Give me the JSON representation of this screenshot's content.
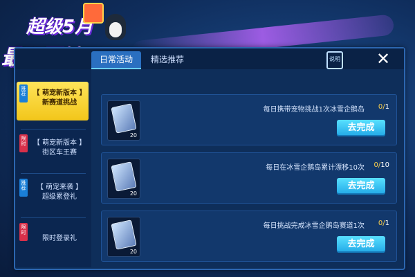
{
  "banner": {
    "line1": "超级5月",
    "line2": "最强回馈"
  },
  "tabs": [
    {
      "label": "日常活动",
      "active": true
    },
    {
      "label": "精选推荐",
      "active": false
    }
  ],
  "header": {
    "doc_label": "说明",
    "close_symbol": "✕"
  },
  "sidebar": {
    "items": [
      {
        "tag": "推荐",
        "tag_color": "#1a7fd8",
        "label": "【 萌宠新版本 】\n新赛道挑战",
        "active": true
      },
      {
        "tag": "限时",
        "tag_color": "#d8304a",
        "label": "【 萌宠新版本 】\n街区车王赛",
        "active": false
      },
      {
        "tag": "推荐",
        "tag_color": "#1a7fd8",
        "label": "【 萌宠来袭 】\n超级累登礼",
        "active": false
      },
      {
        "tag": "限时",
        "tag_color": "#d8304a",
        "label": "限时登录礼",
        "active": false
      }
    ]
  },
  "tasks": [
    {
      "text": "每日携带宠物挑战1次冰雪企鹅岛",
      "done": "0",
      "total": "1",
      "reward_qty": "20",
      "button": "去完成"
    },
    {
      "text": "每日在冰雪企鹅岛累计漂移10次",
      "done": "0",
      "total": "10",
      "reward_qty": "20",
      "button": "去完成"
    },
    {
      "text": "每日挑战完成冰雪企鹅岛赛道1次",
      "done": "0",
      "total": "1",
      "reward_qty": "20",
      "button": "去完成"
    }
  ],
  "colors": {
    "accent_yellow": "#ffd24a",
    "button_blue": "#22a8e6",
    "tag_recommend": "#1a7fd8",
    "tag_limited": "#d8304a"
  }
}
